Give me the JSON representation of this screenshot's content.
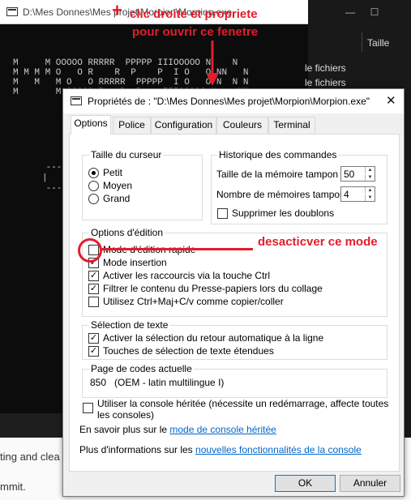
{
  "console": {
    "title": "D:\\Mes Donnes\\Mes projet\\Morpion\\Morpion.exe",
    "ascii_lines": [
      "M     M OOOOO RRRRR  PPPPP IIIOOOOO N    N",
      "M M M M O   O R    R  P    P  I O   O NN   N",
      "M   M   M O   O RRRRR  PPPPP  I O   O N  N N",
      "M       M OOOOO R   R  P    IIIOOOOO N    NN"
    ],
    "grid_fragment": [
      " ---",
      "|",
      " ---"
    ]
  },
  "explorer": {
    "minimize": "—",
    "maximize": "☐",
    "col_label": "Taille",
    "items": [
      "le fichiers",
      "le fichiers"
    ]
  },
  "bottom": {
    "line1": "ting and clea",
    "line2": "mmit."
  },
  "annotations": {
    "top_plus": "+",
    "top_line1": "clic droite et propriete",
    "top_line2": "pour ouvrir ce fenetre",
    "mode_note": "desacticver ce mode"
  },
  "dialog": {
    "title": "Propriétés de : \"D:\\Mes Donnes\\Mes projet\\Morpion\\Morpion.exe\"",
    "close": "✕",
    "tabs": [
      {
        "label": "Options",
        "active": true
      },
      {
        "label": "Police",
        "active": false
      },
      {
        "label": "Configuration",
        "active": false
      },
      {
        "label": "Couleurs",
        "active": false
      },
      {
        "label": "Terminal",
        "active": false
      }
    ],
    "cursor_size": {
      "label": "Taille du curseur",
      "options": [
        {
          "label": "Petit",
          "selected": true
        },
        {
          "label": "Moyen",
          "selected": false
        },
        {
          "label": "Grand",
          "selected": false
        }
      ]
    },
    "history": {
      "label": "Historique des commandes",
      "buffer_size_label": "Taille de la mémoire tampon :",
      "buffer_size_value": "50",
      "buffer_count_label": "Nombre de mémoires tampon :",
      "buffer_count_value": "4",
      "discard_duplicates_label": "Supprimer les doublons",
      "discard_duplicates_checked": false
    },
    "edit_options": {
      "label": "Options d'édition",
      "items": [
        {
          "label": "Mode d'édition rapide",
          "checked": false
        },
        {
          "label": "Mode insertion",
          "checked": true
        },
        {
          "label": "Activer les raccourcis via la touche Ctrl",
          "checked": true
        },
        {
          "label": "Filtrer le contenu du Presse-papiers lors du collage",
          "checked": true
        },
        {
          "label": "Utilisez Ctrl+Maj+C/v comme copier/coller",
          "checked": false
        }
      ]
    },
    "text_selection": {
      "label": "Sélection de texte",
      "items": [
        {
          "label": "Activer la sélection du retour automatique à la ligne",
          "checked": true
        },
        {
          "label": "Touches de sélection de texte étendues",
          "checked": true
        }
      ]
    },
    "codepage": {
      "label": "Page de codes actuelle",
      "value": "850   (OEM - latin multilingue I)"
    },
    "legacy": {
      "line1": "Utiliser la console héritée (nécessite un redémarrage, affecte toutes",
      "line2": "les consoles)",
      "checked": false
    },
    "learn_more_prefix": "En savoir plus sur le ",
    "learn_more_link": "mode de console héritée",
    "more_info_prefix": "Plus d'informations sur les ",
    "more_info_link": "nouvelles fonctionnalités de la console",
    "ok_label": "OK",
    "cancel_label": "Annuler"
  },
  "colors": {
    "annotation_red": "#e31d2b",
    "link_blue": "#0066cc"
  }
}
